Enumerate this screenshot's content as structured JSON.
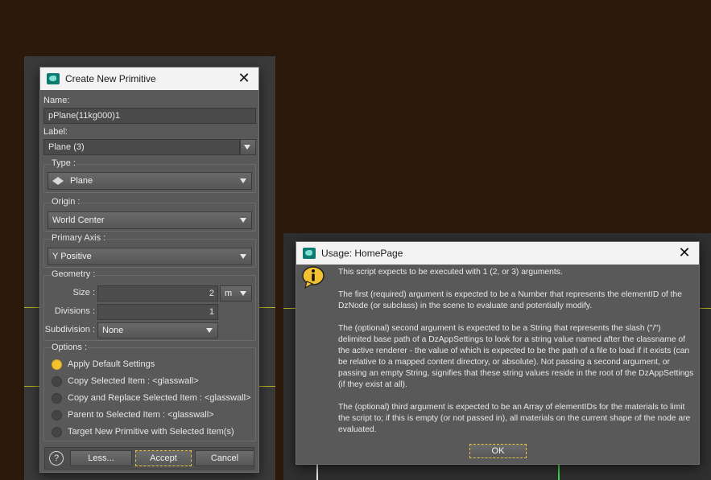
{
  "create_dialog": {
    "title": "Create New Primitive",
    "name_label": "Name:",
    "name_value": "pPlane(11kg000)1",
    "label_label": "Label:",
    "label_value": "Plane (3)",
    "type_title": "Type :",
    "type_value": "Plane",
    "origin_title": "Origin :",
    "origin_value": "World Center",
    "axis_title": "Primary Axis :",
    "axis_value": "Y Positive",
    "geometry_title": "Geometry :",
    "size_label": "Size :",
    "size_value": "2",
    "size_unit": "m",
    "divisions_label": "Divisions :",
    "divisions_value": "1",
    "subdivision_label": "Subdivision :",
    "subdivision_value": "None",
    "options_title": "Options :",
    "options": [
      {
        "label": "Apply Default Settings",
        "selected": true
      },
      {
        "label": "Copy Selected Item : <glasswall>",
        "selected": false
      },
      {
        "label": "Copy and Replace Selected Item : <glasswall>",
        "selected": false
      },
      {
        "label": "Parent to Selected Item : <glasswall>",
        "selected": false
      },
      {
        "label": "Target New Primitive with Selected Item(s)",
        "selected": false
      }
    ],
    "help_label": "?",
    "less_label": "Less...",
    "accept_label": "Accept",
    "cancel_label": "Cancel"
  },
  "usage_dialog": {
    "title": "Usage: HomePage",
    "paragraphs": [
      "This script expects to be executed with 1 (2, or 3) arguments.",
      "The first (required) argument is expected to be a Number that represents the elementID of the DzNode (or subclass) in the scene to evaluate and potentially modify.",
      "The (optional) second argument is expected to be a String that represents the slash (\"/\") delimited base path of a DzAppSettings to look for a string value named after the classname of the active renderer - the value of which is expected to be the path of a file to load if it exists (can be relative to a mapped content directory, or absolute). Not passing a second argument, or passing an empty String, signifies that these string values reside in the root of the DzAppSettings (if they exist at all).",
      "The (optional) third argument is expected to be an Array of elementIDs for the materials to limit the script to; if this is empty (or not passed in), all materials on the current shape of the node are evaluated."
    ],
    "ok_label": "OK"
  },
  "icons": [
    "app-icon",
    "close-icon",
    "plane-icon",
    "dropdown-arrow-icon",
    "help-icon",
    "info-icon"
  ],
  "colors": {
    "accent": "#f2c230",
    "window_bg": "#595959",
    "background": "#2b190c"
  }
}
